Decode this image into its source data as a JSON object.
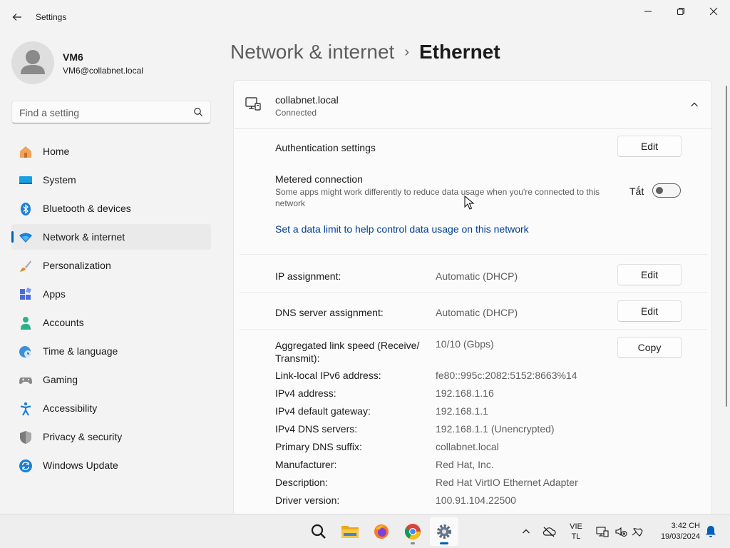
{
  "window": {
    "title": "Settings",
    "controls": [
      "minimize-icon",
      "maximize-icon",
      "close-icon"
    ]
  },
  "profile": {
    "name": "VM6",
    "email": "VM6@collabnet.local"
  },
  "search": {
    "placeholder": "Find a setting",
    "value": ""
  },
  "sidebar": {
    "items": [
      {
        "label": "Home",
        "icon": "home-icon"
      },
      {
        "label": "System",
        "icon": "system-icon"
      },
      {
        "label": "Bluetooth & devices",
        "icon": "bluetooth-icon"
      },
      {
        "label": "Network & internet",
        "icon": "wifi-icon",
        "active": true
      },
      {
        "label": "Personalization",
        "icon": "brush-icon"
      },
      {
        "label": "Apps",
        "icon": "apps-icon"
      },
      {
        "label": "Accounts",
        "icon": "accounts-icon"
      },
      {
        "label": "Time & language",
        "icon": "globe-clock-icon"
      },
      {
        "label": "Gaming",
        "icon": "gamepad-icon"
      },
      {
        "label": "Accessibility",
        "icon": "accessibility-icon"
      },
      {
        "label": "Privacy & security",
        "icon": "shield-icon"
      },
      {
        "label": "Windows Update",
        "icon": "update-icon"
      }
    ]
  },
  "breadcrumb": {
    "parent": "Network & internet",
    "separator": "›",
    "current": "Ethernet"
  },
  "network": {
    "name": "collabnet.local",
    "status": "Connected",
    "auth": {
      "label": "Authentication settings",
      "button": "Edit"
    },
    "metered": {
      "label": "Metered connection",
      "description": "Some apps might work differently to reduce data usage when you're connected to this network",
      "toggle_label": "Tắt",
      "on": false
    },
    "data_limit_link": "Set a data limit to help control data usage on this network",
    "ip_assignment": {
      "label": "IP assignment:",
      "value": "Automatic (DHCP)",
      "button": "Edit"
    },
    "dns_assignment": {
      "label": "DNS server assignment:",
      "value": "Automatic (DHCP)",
      "button": "Edit"
    },
    "link_speed": {
      "label": "Aggregated link speed (Receive/ Transmit):",
      "value": "10/10 (Gbps)",
      "button": "Copy"
    },
    "properties": [
      {
        "label": "Link-local IPv6 address:",
        "value": "fe80::995c:2082:5152:8663%14"
      },
      {
        "label": "IPv4 address:",
        "value": "192.168.1.16"
      },
      {
        "label": "IPv4 default gateway:",
        "value": "192.168.1.1"
      },
      {
        "label": "IPv4 DNS servers:",
        "value": "192.168.1.1 (Unencrypted)"
      },
      {
        "label": "Primary DNS suffix:",
        "value": "collabnet.local"
      },
      {
        "label": "Manufacturer:",
        "value": "Red Hat, Inc."
      },
      {
        "label": "Description:",
        "value": "Red Hat VirtIO Ethernet Adapter"
      },
      {
        "label": "Driver version:",
        "value": "100.91.104.22500"
      }
    ]
  },
  "taskbar": {
    "apps": [
      "search-icon",
      "file-explorer-icon",
      "firefox-icon",
      "chrome-icon",
      "settings-icon"
    ],
    "language": {
      "line1": "VIE",
      "line2": "TL"
    },
    "clock": {
      "time": "3:42 CH",
      "date": "19/03/2024"
    }
  },
  "colors": {
    "accent": "#005fb8",
    "link": "#003e92",
    "background": "#f3f3f3",
    "card": "#fbfbfb"
  }
}
